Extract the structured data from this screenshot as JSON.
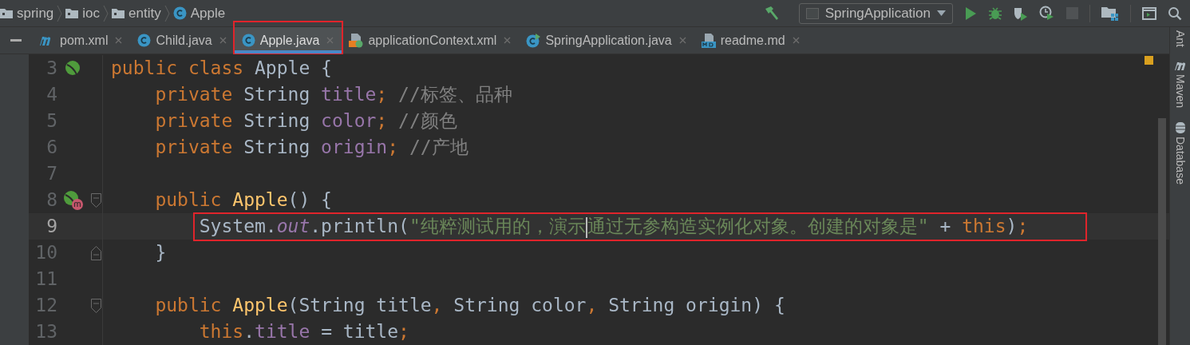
{
  "breadcrumbs": [
    {
      "kind": "folder",
      "label": "spring"
    },
    {
      "kind": "folder",
      "label": "ioc"
    },
    {
      "kind": "folder",
      "label": "entity"
    },
    {
      "kind": "class",
      "label": "Apple"
    }
  ],
  "toolbar": {
    "run_config": "SpringApplication",
    "stop_disabled": true
  },
  "tabs": [
    {
      "kind": "maven",
      "label": "pom.xml",
      "selected": false,
      "annotated": false
    },
    {
      "kind": "class",
      "label": "Child.java",
      "selected": false,
      "annotated": false
    },
    {
      "kind": "class",
      "label": "Apple.java",
      "selected": true,
      "annotated": true
    },
    {
      "kind": "xml",
      "label": "applicationContext.xml",
      "selected": false,
      "annotated": false
    },
    {
      "kind": "main",
      "label": "SpringApplication.java",
      "selected": false,
      "annotated": false
    },
    {
      "kind": "markdown",
      "label": "readme.md",
      "selected": false,
      "annotated": false
    }
  ],
  "lines": [
    {
      "number": "3",
      "bean": true,
      "current": false,
      "annotated": false,
      "tokens": [
        {
          "kind": "keyword",
          "text": "public class "
        },
        {
          "kind": "plain",
          "text": "Apple {"
        }
      ]
    },
    {
      "number": "4",
      "current": false,
      "annotated": false,
      "tokens": [
        {
          "kind": "keyword",
          "text": "    private "
        },
        {
          "kind": "plain",
          "text": "String "
        },
        {
          "kind": "field",
          "text": "title"
        },
        {
          "kind": "keyword",
          "text": "; "
        },
        {
          "kind": "comment",
          "text": "//标签、品种"
        }
      ]
    },
    {
      "number": "5",
      "current": false,
      "annotated": false,
      "tokens": [
        {
          "kind": "keyword",
          "text": "    private "
        },
        {
          "kind": "plain",
          "text": "String "
        },
        {
          "kind": "field",
          "text": "color"
        },
        {
          "kind": "keyword",
          "text": "; "
        },
        {
          "kind": "comment",
          "text": "//颜色"
        }
      ]
    },
    {
      "number": "6",
      "current": false,
      "annotated": false,
      "tokens": [
        {
          "kind": "keyword",
          "text": "    private "
        },
        {
          "kind": "plain",
          "text": "String "
        },
        {
          "kind": "field",
          "text": "origin"
        },
        {
          "kind": "keyword",
          "text": "; "
        },
        {
          "kind": "comment",
          "text": "//产地"
        }
      ]
    },
    {
      "number": "7",
      "current": false,
      "annotated": false
    },
    {
      "number": "8",
      "bean": true,
      "method_marker": true,
      "fold_start": true,
      "current": false,
      "annotated": false,
      "tokens": [
        {
          "kind": "keyword",
          "text": "    public "
        },
        {
          "kind": "method",
          "text": "Apple"
        },
        {
          "kind": "plain",
          "text": "() {"
        }
      ]
    },
    {
      "number": "9",
      "current": true,
      "annotated": true,
      "tokens": [
        {
          "kind": "plain",
          "text": "        System."
        },
        {
          "kind": "static",
          "text": "out"
        },
        {
          "kind": "plain",
          "text": ".println("
        },
        {
          "kind": "string",
          "text": "\"纯粹测试用的，演示"
        },
        {
          "kind": "caret"
        },
        {
          "kind": "string",
          "text": "通过无参构造实例化对象。创建的对象是\""
        },
        {
          "kind": "plain",
          "text": " + "
        },
        {
          "kind": "keyword",
          "text": "this"
        },
        {
          "kind": "plain",
          "text": ")"
        },
        {
          "kind": "keyword",
          "text": ";"
        }
      ]
    },
    {
      "number": "10",
      "fold_end": true,
      "current": false,
      "annotated": false,
      "tokens": [
        {
          "kind": "plain",
          "text": "    }"
        }
      ]
    },
    {
      "number": "11",
      "current": false,
      "annotated": false
    },
    {
      "number": "12",
      "fold_start": true,
      "current": false,
      "annotated": false,
      "tokens": [
        {
          "kind": "keyword",
          "text": "    public "
        },
        {
          "kind": "method",
          "text": "Apple"
        },
        {
          "kind": "plain",
          "text": "(String title"
        },
        {
          "kind": "keyword",
          "text": ", "
        },
        {
          "kind": "plain",
          "text": "String color"
        },
        {
          "kind": "keyword",
          "text": ", "
        },
        {
          "kind": "plain",
          "text": "String origin) {"
        }
      ]
    },
    {
      "number": "13",
      "current": false,
      "annotated": false,
      "tokens": [
        {
          "kind": "keyword",
          "text": "        this"
        },
        {
          "kind": "plain",
          "text": "."
        },
        {
          "kind": "field",
          "text": "title"
        },
        {
          "kind": "plain",
          "text": " = title"
        },
        {
          "kind": "keyword",
          "text": ";"
        }
      ]
    }
  ],
  "tool_windows": [
    {
      "kind": "ant",
      "label": "Ant"
    },
    {
      "kind": "maven",
      "label": "Maven"
    },
    {
      "kind": "database",
      "label": "Database"
    }
  ]
}
